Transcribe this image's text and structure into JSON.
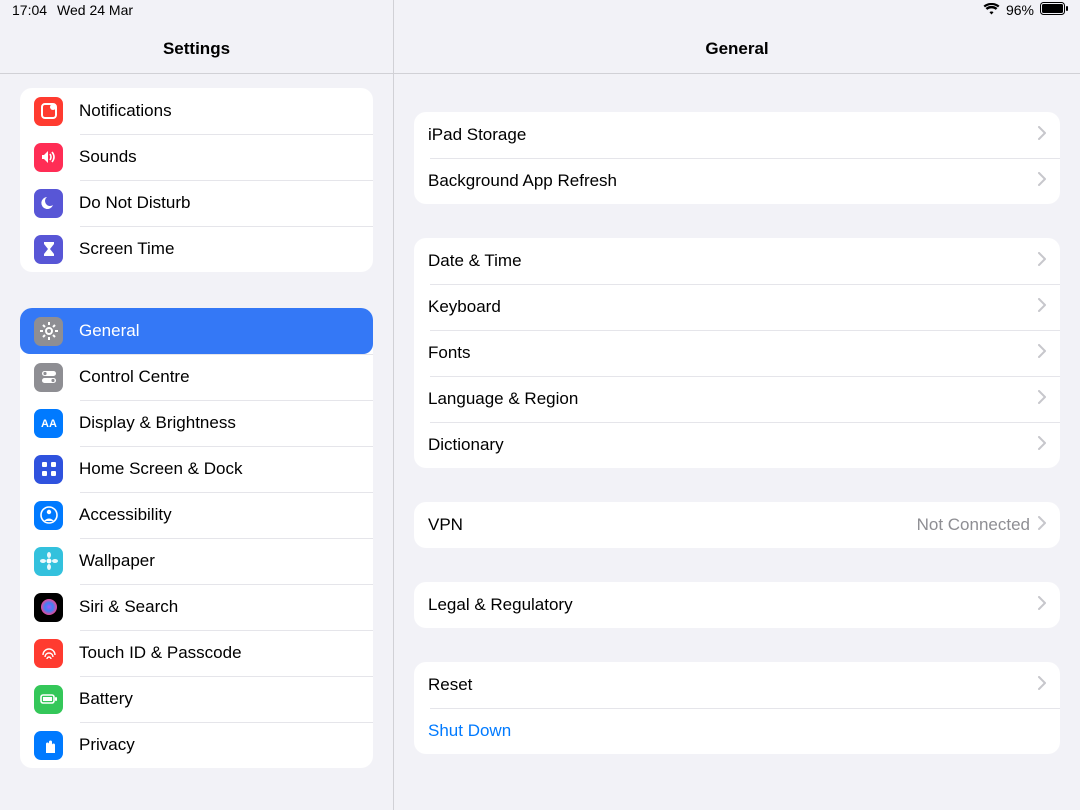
{
  "status": {
    "time": "17:04",
    "date": "Wed 24 Mar",
    "battery": "96%"
  },
  "left": {
    "title": "Settings",
    "group1": [
      {
        "label": "Notifications",
        "icon": "notifications",
        "bg": "#ff3b30"
      },
      {
        "label": "Sounds",
        "icon": "sounds",
        "bg": "#ff2d55"
      },
      {
        "label": "Do Not Disturb",
        "icon": "moon",
        "bg": "#5856d6"
      },
      {
        "label": "Screen Time",
        "icon": "hourglass",
        "bg": "#5856d6"
      }
    ],
    "group2": [
      {
        "label": "General",
        "icon": "gear",
        "bg": "#8e8e93",
        "selected": true
      },
      {
        "label": "Control Centre",
        "icon": "switches",
        "bg": "#8e8e93"
      },
      {
        "label": "Display & Brightness",
        "icon": "aa",
        "bg": "#007aff"
      },
      {
        "label": "Home Screen & Dock",
        "icon": "grid",
        "bg": "#2f52de"
      },
      {
        "label": "Accessibility",
        "icon": "person",
        "bg": "#007aff"
      },
      {
        "label": "Wallpaper",
        "icon": "flower",
        "bg": "#33c1dd"
      },
      {
        "label": "Siri & Search",
        "icon": "siri",
        "bg": "#000"
      },
      {
        "label": "Touch ID & Passcode",
        "icon": "fingerprint",
        "bg": "#ff3b30"
      },
      {
        "label": "Battery",
        "icon": "battery",
        "bg": "#34c759"
      },
      {
        "label": "Privacy",
        "icon": "hand",
        "bg": "#007aff"
      }
    ]
  },
  "right": {
    "title": "General",
    "group1": [
      {
        "label": "iPad Storage"
      },
      {
        "label": "Background App Refresh"
      }
    ],
    "group2": [
      {
        "label": "Date & Time"
      },
      {
        "label": "Keyboard"
      },
      {
        "label": "Fonts"
      },
      {
        "label": "Language & Region"
      },
      {
        "label": "Dictionary"
      }
    ],
    "group3": [
      {
        "label": "VPN",
        "detail": "Not Connected"
      }
    ],
    "group4": [
      {
        "label": "Legal & Regulatory"
      }
    ],
    "group5": [
      {
        "label": "Reset",
        "chevron": true
      },
      {
        "label": "Shut Down",
        "link": true
      }
    ]
  }
}
